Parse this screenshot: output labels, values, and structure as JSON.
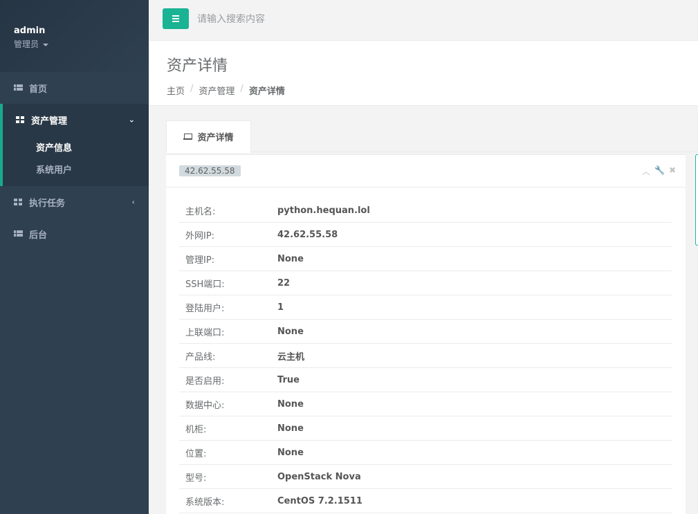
{
  "sidebar": {
    "profile": {
      "name": "admin",
      "role": "管理员"
    },
    "items": [
      {
        "label": "首页"
      },
      {
        "label": "资产管理",
        "arrow": "⌄"
      },
      {
        "label": "执行任务",
        "arrow": "‹"
      },
      {
        "label": "后台"
      }
    ],
    "sub_items": [
      {
        "label": "资产信息"
      },
      {
        "label": "系统用户"
      }
    ]
  },
  "topbar": {
    "search_placeholder": "请输入搜索内容"
  },
  "header": {
    "title": "资产详情",
    "breadcrumb": [
      "主页",
      "资产管理",
      "资产详情"
    ],
    "separator": "/"
  },
  "tab": {
    "label": "资产详情"
  },
  "panel": {
    "badge": "42.62.55.58",
    "tools": {
      "collapse": "︿",
      "config": "🔧",
      "close": "✖"
    }
  },
  "details": [
    {
      "key": "主机名:",
      "value": "python.hequan.lol"
    },
    {
      "key": "外网IP:",
      "value": "42.62.55.58"
    },
    {
      "key": "管理IP:",
      "value": "None"
    },
    {
      "key": "SSH端口:",
      "value": "22"
    },
    {
      "key": "登陆用户:",
      "value": "1"
    },
    {
      "key": "上联端口:",
      "value": "None"
    },
    {
      "key": "产品线:",
      "value": "云主机"
    },
    {
      "key": "是否启用:",
      "value": "True"
    },
    {
      "key": "数据中心:",
      "value": "None"
    },
    {
      "key": "机柜:",
      "value": "None"
    },
    {
      "key": "位置:",
      "value": "None"
    },
    {
      "key": "型号:",
      "value": "OpenStack Nova"
    },
    {
      "key": "系统版本:",
      "value": "CentOS 7.2.1511"
    }
  ],
  "colors": {
    "accent": "#1ab394",
    "sidebar_bg": "#2f4050",
    "active_group_bg": "#293846"
  }
}
